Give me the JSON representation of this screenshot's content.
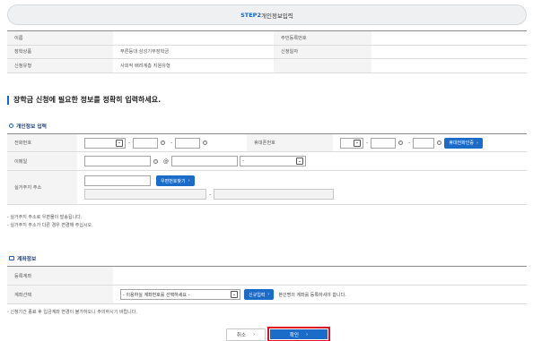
{
  "step_bar": {
    "step": "STEP2",
    "title": "개인정보입력"
  },
  "info_table": {
    "rows": [
      {
        "label1": "이름",
        "value1": "",
        "label2": "주민등록번호",
        "value2": ""
      },
      {
        "label1": "장학상품",
        "value1": "푸른등대 삼성기부장학금",
        "label2": "신청일자",
        "value2": ""
      },
      {
        "label1": "신청유형",
        "value1": "사회적 배려계층 지원유형",
        "label2": "",
        "value2": ""
      }
    ]
  },
  "section_title": "장학금 신청에 필요한 정보를 정확히 입력하세요.",
  "personal": {
    "title": "개인정보 입력",
    "phone_label": "전화번호",
    "mobile_label": "휴대폰번호",
    "mobile_verify_button": "휴대전화인증",
    "email_label": "이메일",
    "email_at": "@",
    "address_label": "실거주지 주소",
    "postcode_button": "우편번호찾기",
    "dash": "-",
    "circle_mark": "ⓡ"
  },
  "notes_personal": [
    "- 실거주지 주소로 우편물이 발송됩니다.",
    "- 실거주지 주소가 다른 경우 변경해 주십시오."
  ],
  "account": {
    "title": "계좌정보",
    "registered_label": "등록계좌",
    "registered_value": "",
    "select_label": "계좌선택",
    "select_placeholder": "- 이용하실 계좌번호를 선택하세요 -",
    "new_input_button": "신규입력",
    "guide": "본인명의 계좌를 등록하셔야 합니다."
  },
  "notes_account": [
    "- 신청기간 종료 후 입금계좌 변경이 불가하오니 주의하시기 바랍니다."
  ],
  "actions": {
    "cancel": "취소",
    "ok": "확인",
    "arrow": "›"
  },
  "icons": {
    "dropdown": "dropdown-arrow-icon",
    "chevron": "chevron-right-icon"
  },
  "colors": {
    "accent_blue": "#1a6cc8",
    "highlight_red": "#e01020",
    "header_bg": "#eef0f2"
  }
}
